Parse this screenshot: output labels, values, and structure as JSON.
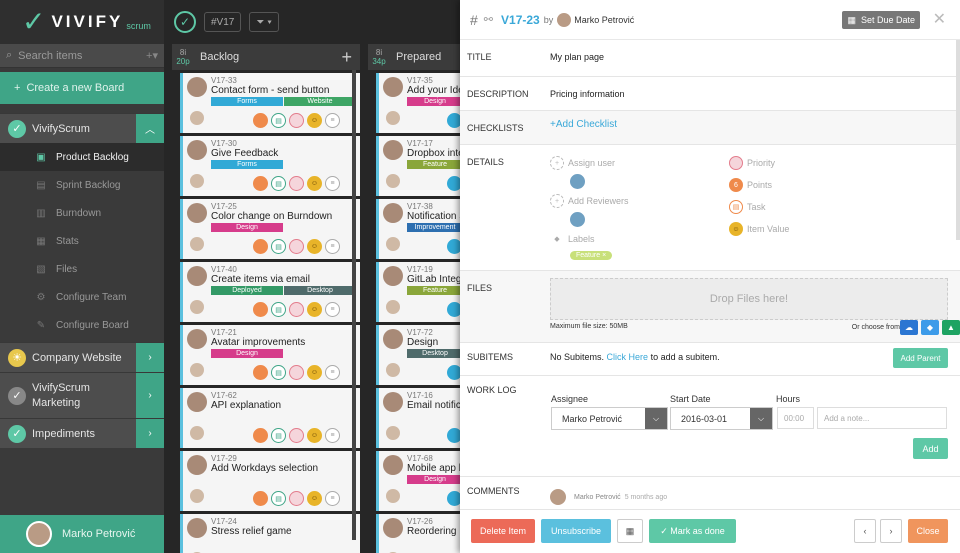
{
  "sidebar": {
    "logo_word": "VIVIFY",
    "logo_sub": "scrum",
    "search_placeholder": "Search items",
    "create_board": "Create a new Board",
    "groups": [
      {
        "label": "VivifyScrum",
        "items": [
          "Product Backlog",
          "Sprint Backlog",
          "Burndown",
          "Stats",
          "Files",
          "Configure Team",
          "Configure Board"
        ]
      },
      {
        "label": "Company Website"
      },
      {
        "label_line1": "VivifyScrum",
        "label_line2": "Marketing"
      },
      {
        "label": "Impediments"
      }
    ],
    "user_name": "Marko Petrović"
  },
  "board": {
    "sprint_chip": "#V17",
    "columns": [
      {
        "count": "8i",
        "points": "20p",
        "name": "Backlog"
      },
      {
        "count": "8i",
        "points": "34p",
        "name": "Prepared"
      }
    ],
    "backlog_cards": [
      {
        "id": "V17-33",
        "title": "Contact form - send button",
        "tags": [
          {
            "t": "Forms",
            "c": "cyan"
          },
          {
            "t": "Website",
            "c": "green"
          }
        ]
      },
      {
        "id": "V17-30",
        "title": "Give Feedback",
        "tags": [
          {
            "t": "Forms",
            "c": "cyan"
          }
        ]
      },
      {
        "id": "V17-25",
        "title": "Color change on Burndown",
        "tags": [
          {
            "t": "Design",
            "c": "pink"
          }
        ]
      },
      {
        "id": "V17-40",
        "title": "Create items via email",
        "tags": [
          {
            "t": "Deployed",
            "c": "dgreen"
          },
          {
            "t": "Desktop",
            "c": "gray"
          }
        ]
      },
      {
        "id": "V17-21",
        "title": "Avatar improvements",
        "tags": [
          {
            "t": "Design",
            "c": "pink"
          }
        ]
      },
      {
        "id": "V17-62",
        "title": "API explanation",
        "tags": []
      },
      {
        "id": "V17-29",
        "title": "Add Workdays selection",
        "tags": []
      },
      {
        "id": "V17-24",
        "title": "Stress relief game",
        "tags": []
      }
    ],
    "prepared_cards": [
      {
        "id": "V17-35",
        "title": "Add your Idea",
        "tags": [
          {
            "t": "Design",
            "c": "pink"
          }
        ]
      },
      {
        "id": "V17-17",
        "title": "Dropbox integ",
        "tags": [
          {
            "t": "Feature",
            "c": "olive"
          }
        ]
      },
      {
        "id": "V17-38",
        "title": "Notification Se",
        "tags": [
          {
            "t": "Improvement",
            "c": "navy"
          }
        ]
      },
      {
        "id": "V17-19",
        "title": "GitLab Integra",
        "tags": [
          {
            "t": "Feature",
            "c": "olive"
          }
        ]
      },
      {
        "id": "V17-72",
        "title": "Design",
        "tags": [
          {
            "t": "Desktop",
            "c": "gray"
          }
        ]
      },
      {
        "id": "V17-16",
        "title": "Email notificat",
        "tags": []
      },
      {
        "id": "V17-68",
        "title": "Mobile app la",
        "tags": [
          {
            "t": "Design",
            "c": "pink"
          }
        ]
      },
      {
        "id": "V17-26",
        "title": "Reordering Ka",
        "tags": []
      }
    ]
  },
  "panel": {
    "item_id": "V17-23",
    "by": "by",
    "author": "Marko Petrović",
    "set_due_date": "Set Due Date",
    "title_label": "TITLE",
    "title_value": "My plan page",
    "description_label": "DESCRIPTION",
    "description_value": "Pricing information",
    "checklists_label": "CHECKLISTS",
    "add_checklist": "+Add Checklist",
    "details_label": "DETAILS",
    "assign_user": "Assign user",
    "add_reviewers": "Add Reviewers",
    "labels": "Labels",
    "feature_tag": "Feature ×",
    "priority": "Priority",
    "points_value": "6",
    "points": "Points",
    "task": "Task",
    "item_value": "Item Value",
    "files_label": "FILES",
    "drop_files": "Drop Files here!",
    "max_file": "Maximum file size: 50MB",
    "or_choose": "Or choose from",
    "subitems_label": "SUBITEMS",
    "no_subitems": "No Subitems.",
    "click_here": "Click Here",
    "add_subitem": "to add a subitem.",
    "add_parent": "Add Parent",
    "worklog_label": "WORK LOG",
    "assignee_label": "Assignee",
    "assignee_value": "Marko Petrović",
    "start_date_label": "Start Date",
    "start_date_value": "2016-03-01",
    "hours_label": "Hours",
    "hours_placeholder": "00:00",
    "note_placeholder": "Add a note...",
    "add_btn": "Add",
    "comments_label": "COMMENTS",
    "comment_author": "Marko Petrović",
    "comment_time": "5 months ago",
    "delete_item": "Delete Item",
    "unsubscribe": "Unsubscribe",
    "mark_done": "✓ Mark as done",
    "close": "Close"
  }
}
